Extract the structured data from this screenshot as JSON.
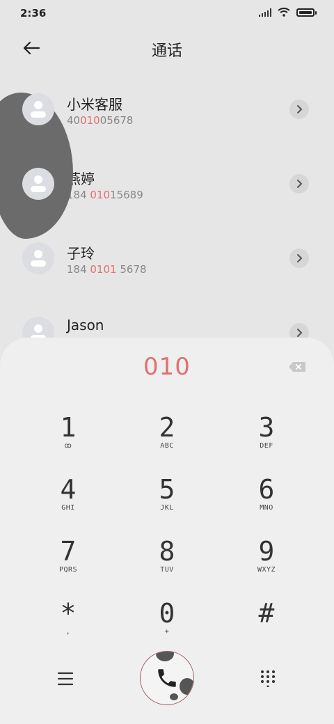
{
  "status": {
    "time": "2:36"
  },
  "header": {
    "title": "通话"
  },
  "contacts": [
    {
      "name": "小米客服",
      "number_pre": "40",
      "number_hl": "010",
      "number_post": "05678"
    },
    {
      "name": "燕婷",
      "number_pre": "184 ",
      "number_hl": "010",
      "number_post": "15689"
    },
    {
      "name": "子玲",
      "number_pre": "184 ",
      "number_hl": "0101",
      "number_post": " 5678"
    },
    {
      "name": "Jason",
      "number_pre": "",
      "number_hl": "",
      "number_post": ""
    }
  ],
  "dialer": {
    "input": "010",
    "keys": [
      {
        "digit": "1",
        "letters": "ꝏ"
      },
      {
        "digit": "2",
        "letters": "ABC"
      },
      {
        "digit": "3",
        "letters": "DEF"
      },
      {
        "digit": "4",
        "letters": "GHI"
      },
      {
        "digit": "5",
        "letters": "JKL"
      },
      {
        "digit": "6",
        "letters": "MNO"
      },
      {
        "digit": "7",
        "letters": "PQRS"
      },
      {
        "digit": "8",
        "letters": "TUV"
      },
      {
        "digit": "9",
        "letters": "WXYZ"
      },
      {
        "digit": "*",
        "letters": ","
      },
      {
        "digit": "0",
        "letters": "+"
      },
      {
        "digit": "#",
        "letters": ""
      }
    ]
  },
  "colors": {
    "accent": "#e07070",
    "text": "#333333"
  }
}
